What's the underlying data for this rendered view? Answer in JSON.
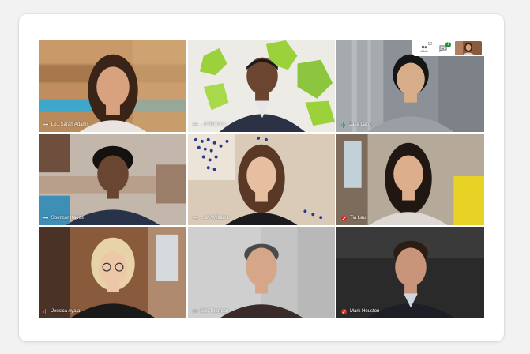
{
  "topbar": {
    "participants_count": "10",
    "chat_badge": "1",
    "icons": [
      "people-icon",
      "chat-icon"
    ]
  },
  "tiles": [
    {
      "name": "Lo...Sarah Adams",
      "audio": "dots"
    },
    {
      "name": "...ff Skidden",
      "audio": "dots"
    },
    {
      "name": "Jace Lazo",
      "audio": "speaking"
    },
    {
      "name": "Spencer Kaoes",
      "audio": "dots"
    },
    {
      "name": "...ah Williams",
      "audio": "dots"
    },
    {
      "name": "Tia Lau",
      "audio": "muted"
    },
    {
      "name": "Jessica Ayala",
      "audio": "speaking"
    },
    {
      "name": "Bell Thornton",
      "audio": "dots"
    },
    {
      "name": "Mark Houston",
      "audio": "muted"
    }
  ],
  "colors": {
    "card": "#ffffff",
    "page": "#f2f2f2",
    "muted_red": "#d93025",
    "speaking_green": "#34a853",
    "badge_green": "#1e8e3e"
  }
}
